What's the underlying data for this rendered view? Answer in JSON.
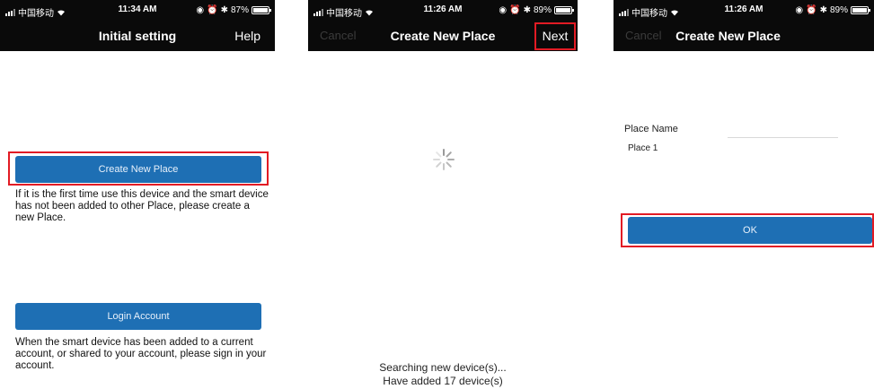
{
  "screens": [
    {
      "status": {
        "carrier": "中国移动",
        "time": "11:34 AM",
        "battery": "87%",
        "battery_level": 0.87
      },
      "nav": {
        "title": "Initial setting",
        "right": "Help"
      },
      "create_button": "Create New Place",
      "create_desc": "If it is the first time use this device and the smart device has not been added to other Place, please create a new Place.",
      "login_button": "Login Account",
      "login_desc": "When the smart device has been added to a current account, or shared to your account, please sign in your account."
    },
    {
      "status": {
        "carrier": "中国移动",
        "time": "11:26 AM",
        "battery": "89%",
        "battery_level": 0.89
      },
      "nav": {
        "left": "Cancel",
        "title": "Create New Place",
        "right": "Next"
      },
      "searching_text": "Searching new device(s)...",
      "added_text": "Have added 17 device(s)"
    },
    {
      "status": {
        "carrier": "中国移动",
        "time": "11:26 AM",
        "battery": "89%",
        "battery_level": 0.89
      },
      "nav": {
        "left": "Cancel",
        "title": "Create New Place"
      },
      "place_name_label": "Place Name",
      "place_name_value": "Place 1",
      "ok_button": "OK"
    }
  ],
  "colors": {
    "navbar": "#0a0a0a",
    "button": "#1e6fb4",
    "highlight": "#e21b24"
  }
}
